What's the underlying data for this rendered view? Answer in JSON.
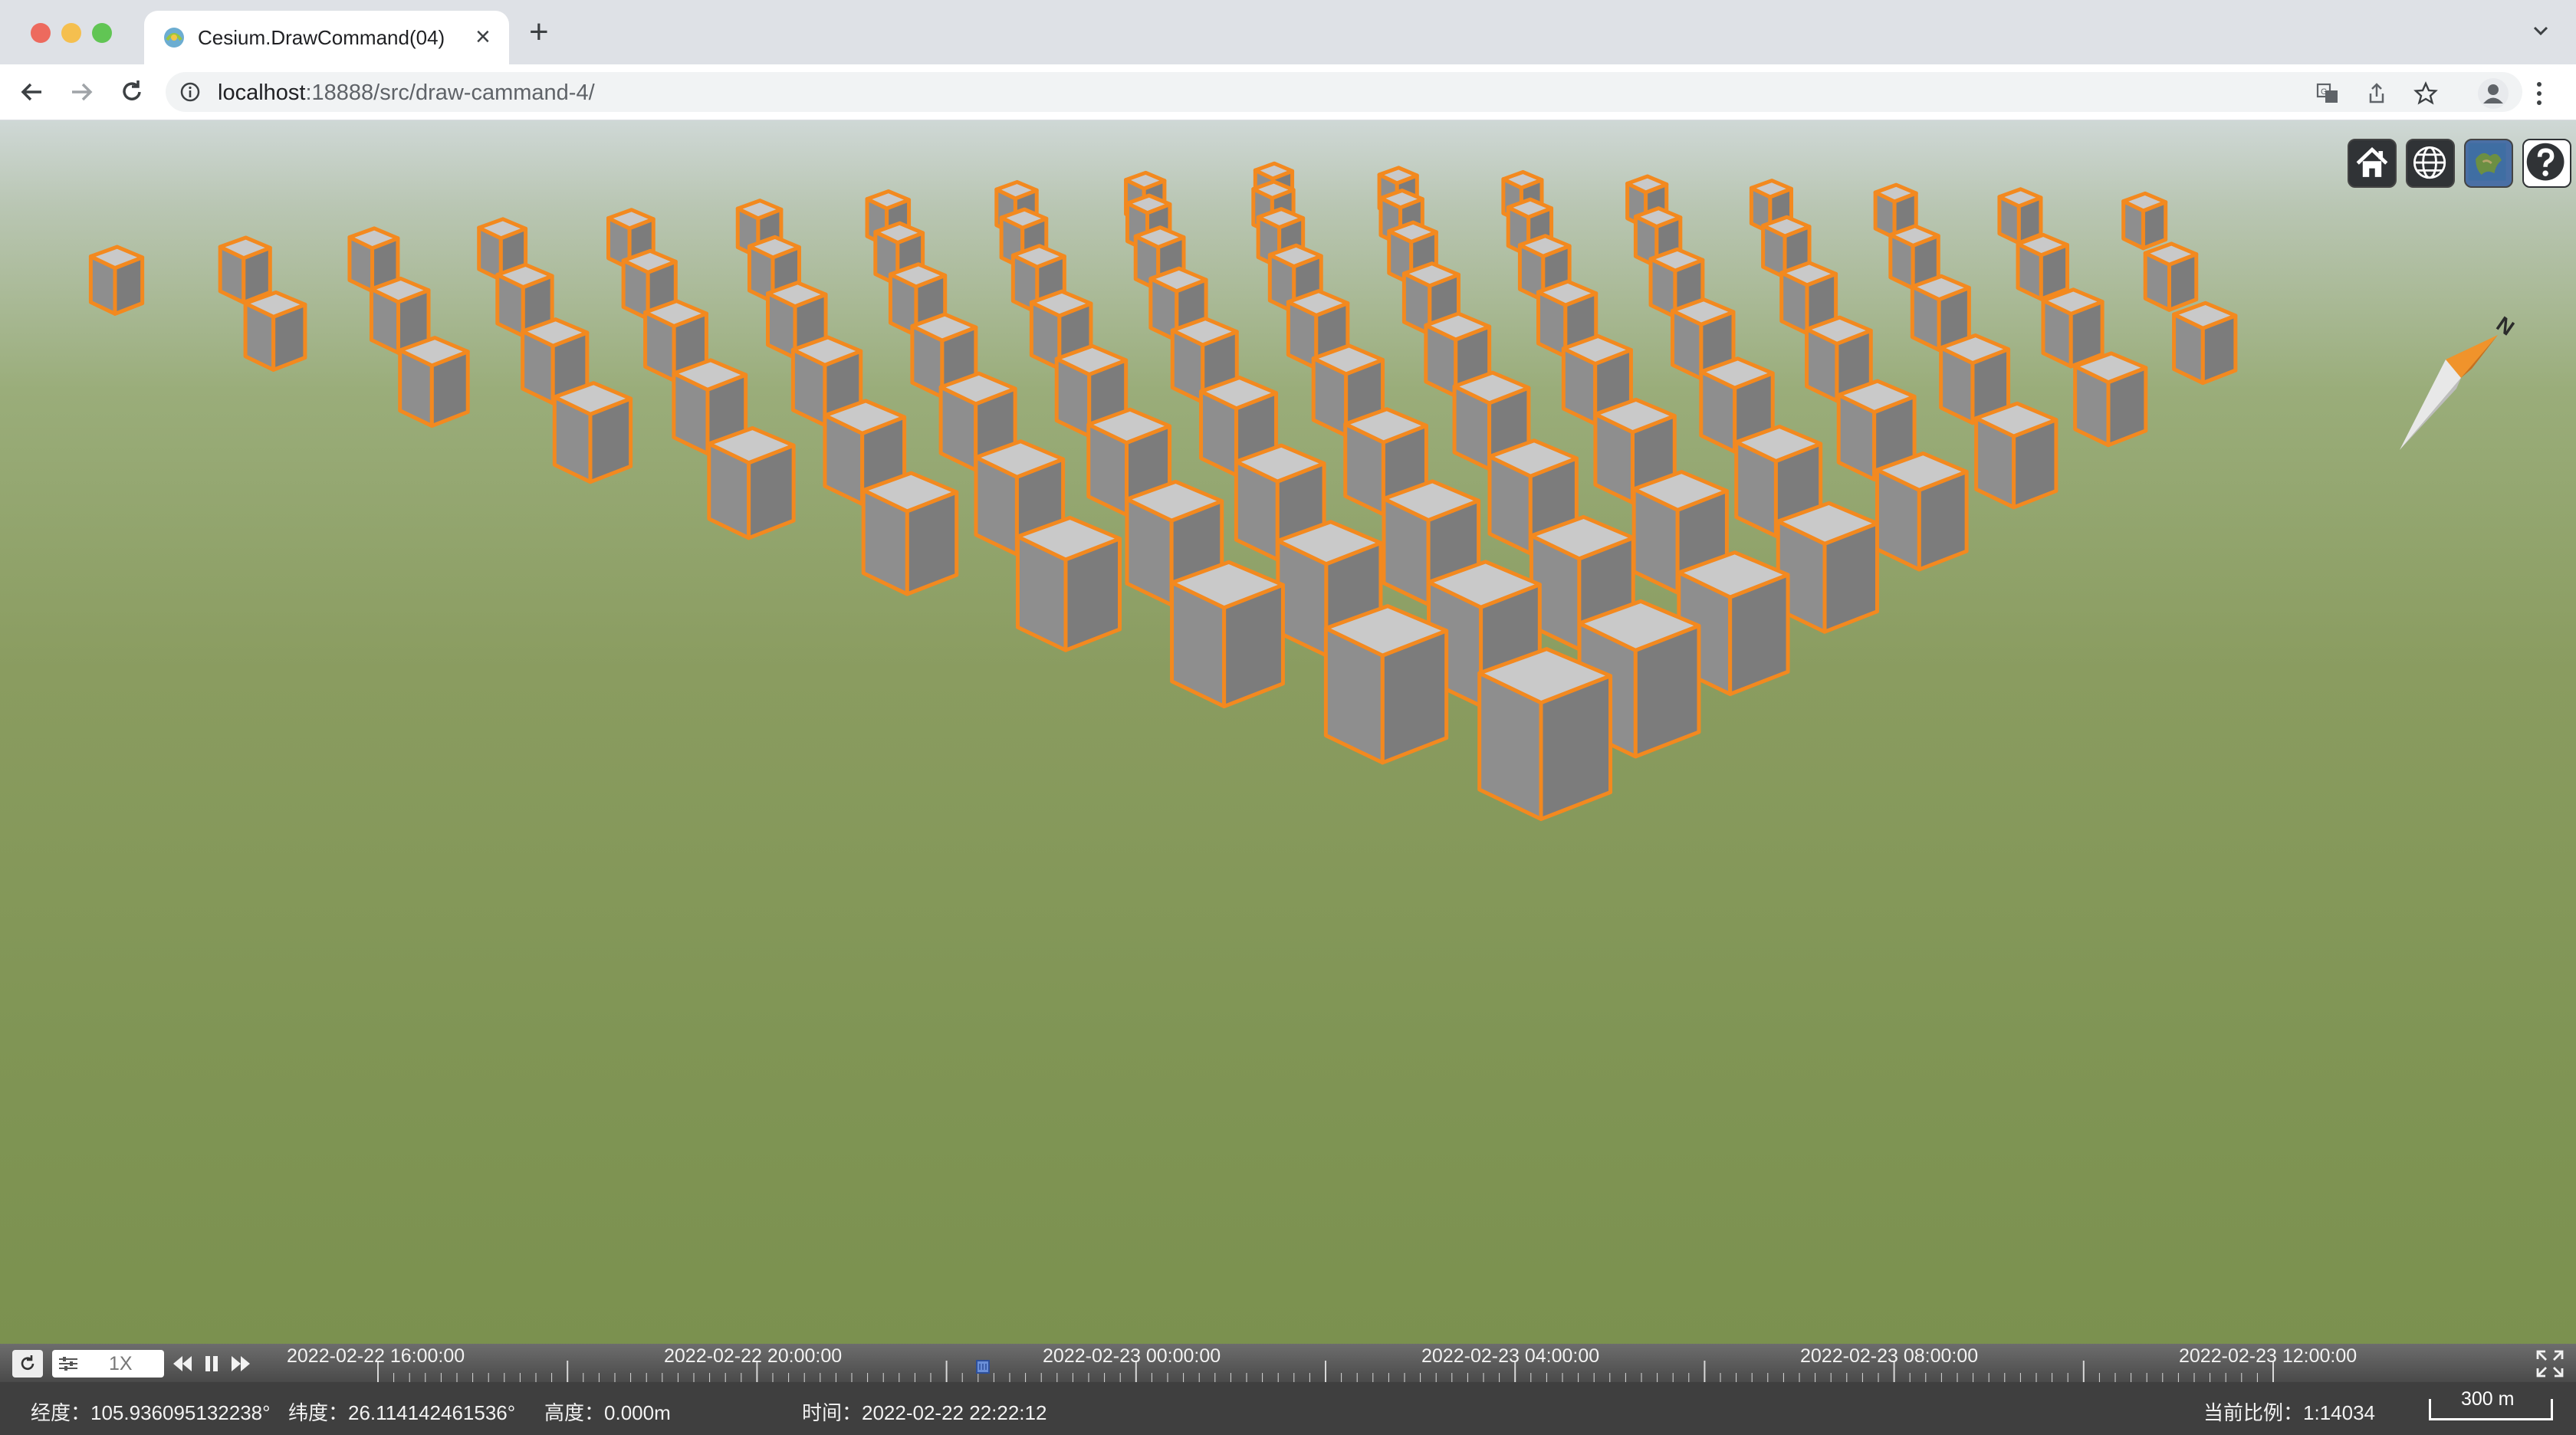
{
  "browser": {
    "tab_title": "Cesium.DrawCommand(04)",
    "url_host": "localhost",
    "url_rest": ":18888/src/draw-cammand-4/"
  },
  "viewer": {
    "toolbar_buttons": [
      "home-icon",
      "globe-icon",
      "layers-icon",
      "help-icon"
    ],
    "compass_label": "N",
    "box_colors": {
      "top": "#c9c9c9",
      "left": "#8e8e8e",
      "right": "#7c7c7c",
      "outline": "#f3891f"
    }
  },
  "timeline": {
    "speed": "1X",
    "labels": [
      "2022-02-22 16:00:00",
      "2022-02-22 20:00:00",
      "2022-02-23 00:00:00",
      "2022-02-23 04:00:00",
      "2022-02-23 08:00:00",
      "2022-02-23 12:00:00"
    ]
  },
  "status": {
    "lon_label": "经度：",
    "lon": "105.936095132238°",
    "lat_label": "纬度：",
    "lat": "26.114142461536°",
    "alt_label": "高度：",
    "alt": "0.000m",
    "time_label": "时间：",
    "time": "2022-02-22 22:22:12",
    "scale_label": "当前比例：",
    "scale": "1:14034",
    "scalebar": "300 m"
  }
}
